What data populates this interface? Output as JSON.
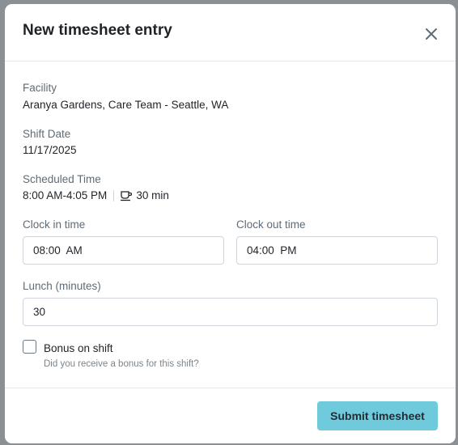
{
  "modal": {
    "title": "New timesheet entry",
    "close_icon": "close-icon"
  },
  "facility": {
    "label": "Facility",
    "value": "Aranya Gardens, Care Team - Seattle, WA"
  },
  "shift_date": {
    "label": "Shift Date",
    "value": "11/17/2025"
  },
  "scheduled_time": {
    "label": "Scheduled Time",
    "time_range": "8:00 AM-4:05 PM",
    "break_icon": "coffee-cup-icon",
    "break_duration": "30 min"
  },
  "clock_in": {
    "label": "Clock in time",
    "value": "08:00  AM"
  },
  "clock_out": {
    "label": "Clock out time",
    "value": "04:00  PM"
  },
  "lunch": {
    "label": "Lunch (minutes)",
    "value": "30"
  },
  "bonus": {
    "label": "Bonus on shift",
    "help": "Did you receive a bonus for this shift?",
    "checked": false
  },
  "footer": {
    "submit_label": "Submit timesheet"
  },
  "colors": {
    "submit_bg": "#6fcbdc",
    "text": "#1f2328",
    "label": "#5f6b76"
  }
}
